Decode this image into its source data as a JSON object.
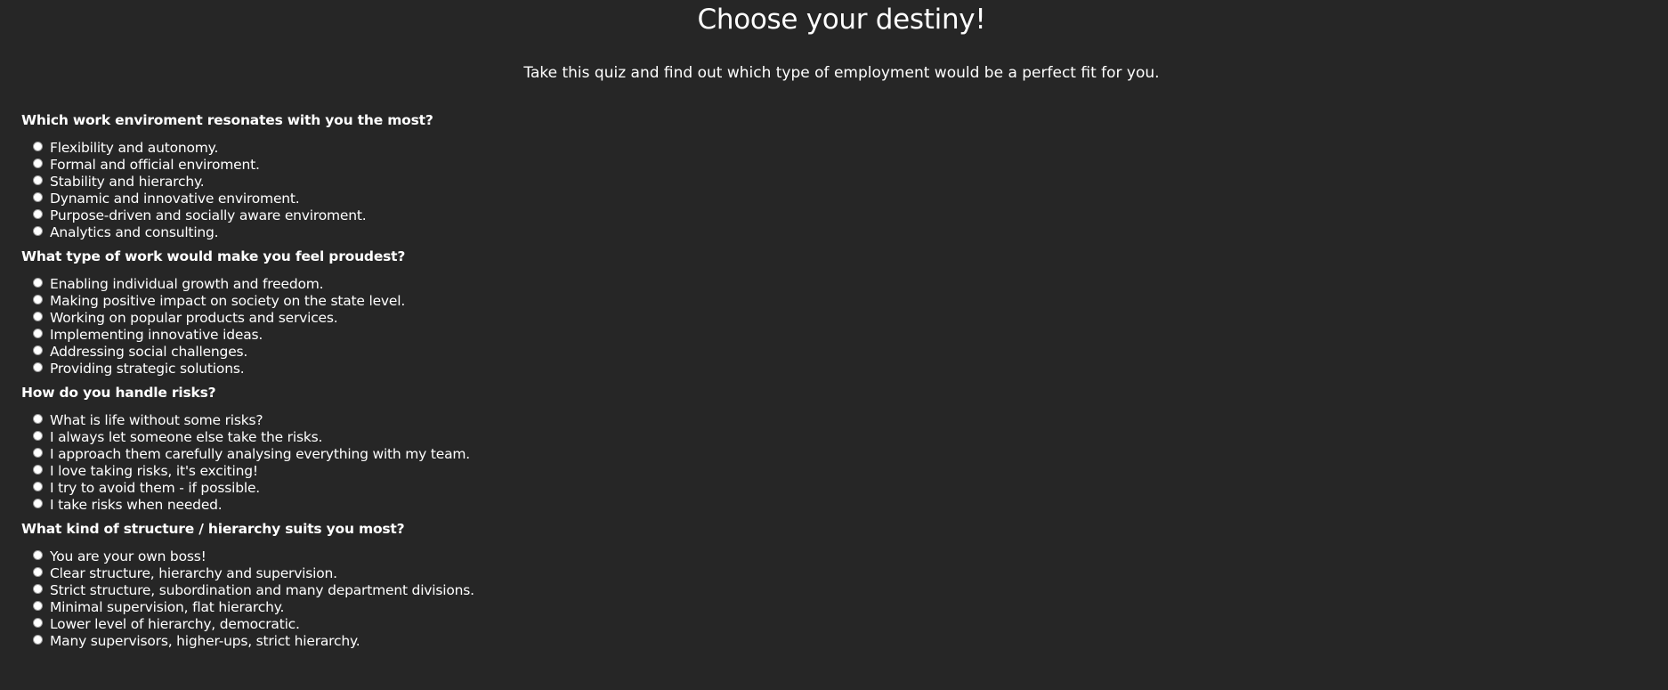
{
  "header": {
    "title": "Choose your destiny!",
    "subtitle": "Take this quiz and find out which type of employment would be a perfect fit for you."
  },
  "questions": [
    {
      "title": "Which work enviroment resonates with you the most?",
      "options": [
        "Flexibility and autonomy.",
        "Formal and official enviroment.",
        "Stability and hierarchy.",
        "Dynamic and innovative enviroment.",
        "Purpose-driven and socially aware enviroment.",
        "Analytics and consulting."
      ]
    },
    {
      "title": "What type of work would make you feel proudest?",
      "options": [
        "Enabling individual growth and freedom.",
        "Making positive impact on society on the state level.",
        "Working on popular products and services.",
        "Implementing innovative ideas.",
        "Addressing social challenges.",
        "Providing strategic solutions."
      ]
    },
    {
      "title": "How do you handle risks?",
      "options": [
        "What is life without some risks?",
        "I always let someone else take the risks.",
        "I approach them carefully analysing everything with my team.",
        "I love taking risks, it's exciting!",
        "I try to avoid them - if possible.",
        "I take risks when needed."
      ]
    },
    {
      "title": "What kind of structure / hierarchy suits you most?",
      "options": [
        "You are your own boss!",
        "Clear structure, hierarchy and supervision.",
        "Strict structure, subordination and many department divisions.",
        "Minimal supervision, flat hierarchy.",
        "Lower level of hierarchy, democratic.",
        "Many supervisors, higher-ups, strict hierarchy."
      ]
    }
  ]
}
